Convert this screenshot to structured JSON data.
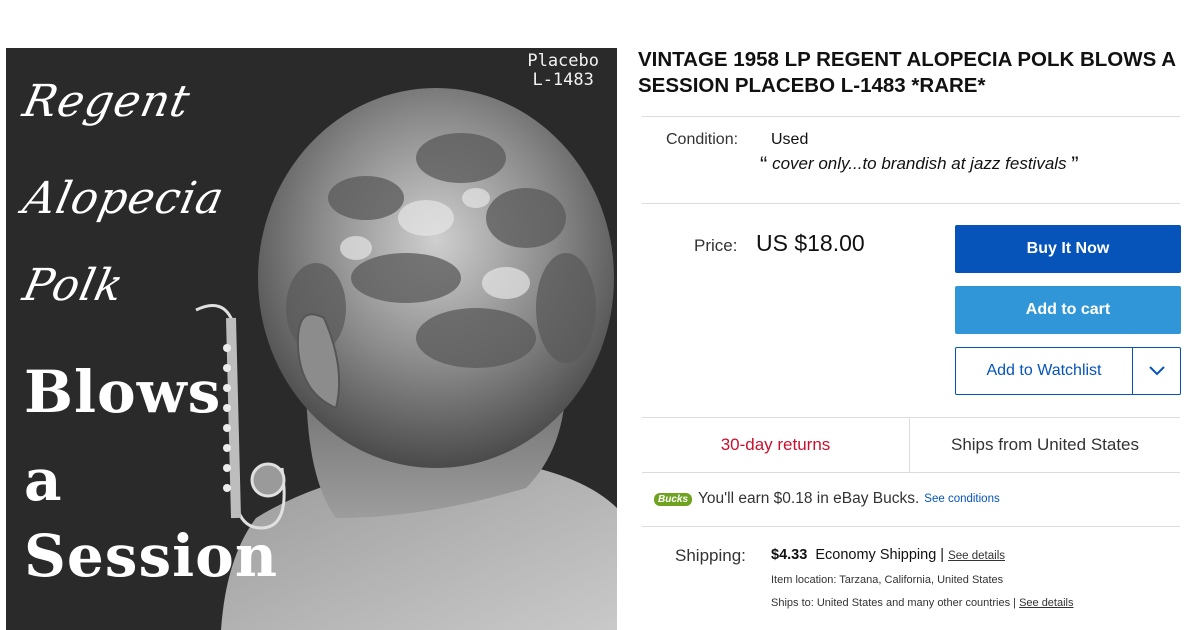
{
  "cover": {
    "catalog_line1": "Placebo",
    "catalog_line2": "L-1483",
    "script_lines": [
      "Regent",
      "Alopecia",
      "Polk"
    ],
    "stencil_lines": [
      "Blows",
      "a",
      "Session"
    ]
  },
  "listing": {
    "title": "VINTAGE 1958 LP REGENT ALOPECIA POLK BLOWS A SESSION PLACEBO L-1483 *RARE*",
    "condition_label": "Condition:",
    "condition_value": "Used",
    "condition_note": "cover only...to brandish at jazz festivals",
    "price_label": "Price:",
    "price_value": "US $18.00",
    "buy_now": "Buy It Now",
    "add_to_cart": "Add to cart",
    "watchlist": "Add to Watchlist",
    "returns": "30-day returns",
    "ships_from": "Ships from United States",
    "bucks_badge": "Bucks",
    "bucks_text": "You'll earn $0.18 in eBay Bucks.",
    "bucks_link": "See conditions",
    "shipping_label": "Shipping:",
    "shipping_amount": "$4.33",
    "shipping_method": "Economy Shipping |",
    "shipping_link": "See details",
    "item_location": "Item location:  Tarzana, California, United States",
    "ships_to": "Ships to:  United States and many other countries |",
    "ships_to_link": "See details"
  },
  "colors": {
    "primary_button": "#0654ba",
    "secondary_button": "#3196d7",
    "returns_text": "#c8102e",
    "bucks_badge": "#6fa21f"
  },
  "icons": {
    "watchlist_dropdown": "chevron-down-icon",
    "saxophone": "saxophone-icon"
  }
}
